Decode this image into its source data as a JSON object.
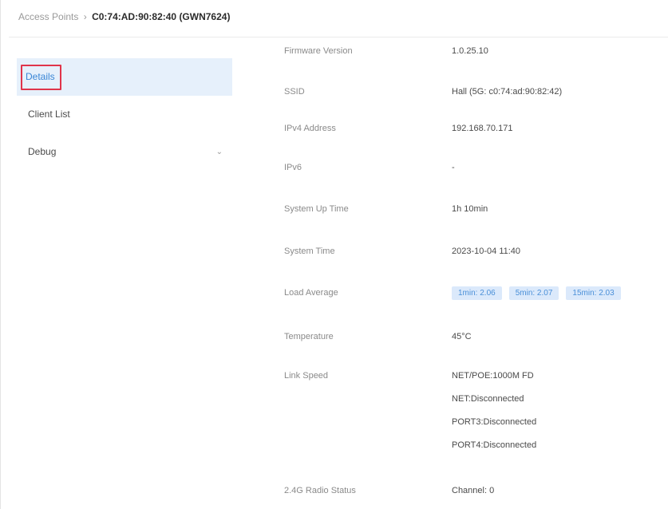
{
  "breadcrumb": {
    "parent": "Access Points",
    "separator": "›",
    "current": "C0:74:AD:90:82:40 (GWN7624)"
  },
  "sidebar": {
    "items": [
      {
        "label": "Details"
      },
      {
        "label": "Client List"
      },
      {
        "label": "Debug"
      }
    ]
  },
  "details": {
    "firmware_version": {
      "label": "Firmware Version",
      "value": "1.0.25.10"
    },
    "ssid": {
      "label": "SSID",
      "value": "Hall (5G: c0:74:ad:90:82:42)"
    },
    "ipv4": {
      "label": "IPv4 Address",
      "value": "192.168.70.171"
    },
    "ipv6": {
      "label": "IPv6",
      "value": "-"
    },
    "uptime": {
      "label": "System Up Time",
      "value": "1h 10min"
    },
    "system_time": {
      "label": "System Time",
      "value": "2023-10-04 11:40"
    },
    "load_average": {
      "label": "Load Average",
      "badges": [
        "1min: 2.06",
        "5min: 2.07",
        "15min: 2.03"
      ]
    },
    "temperature": {
      "label": "Temperature",
      "value": "45°C"
    },
    "link_speed": {
      "label": "Link Speed",
      "lines": [
        "NET/POE:1000M FD",
        "NET:Disconnected",
        "PORT3:Disconnected",
        "PORT4:Disconnected"
      ]
    },
    "radio_24": {
      "label": "2.4G Radio Status",
      "value": "Channel: 0"
    }
  },
  "colors": {
    "active_bg": "#e6f0fb",
    "active_text": "#3a86d6",
    "highlight_border": "#e0344a",
    "badge_bg": "#dbe9fb"
  }
}
